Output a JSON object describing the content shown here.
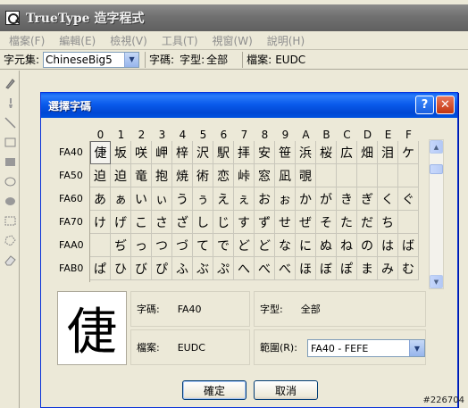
{
  "app": {
    "title": "TrueType 造字程式",
    "menu": [
      "檔案(F)",
      "編輯(E)",
      "檢視(V)",
      "工具(T)",
      "視窗(W)",
      "說明(H)"
    ],
    "toolbar": {
      "charset_label": "字元集:",
      "charset_value": "ChineseBig5",
      "code_label": "字碼:",
      "font_label": "字型:",
      "font_value": "全部",
      "file_label": "檔案:",
      "file_value": "EUDC"
    }
  },
  "dialog": {
    "title": "選擇字碼",
    "columns": [
      "0",
      "1",
      "2",
      "3",
      "4",
      "5",
      "6",
      "7",
      "8",
      "9",
      "A",
      "B",
      "C",
      "D",
      "E",
      "F"
    ],
    "rows": [
      {
        "code": "FA40",
        "chars": [
          "倢",
          "坂",
          "咲",
          "岬",
          "梓",
          "沢",
          "駅",
          "拝",
          "安",
          "笹",
          "浜",
          "桜",
          "広",
          "畑",
          "泪",
          "ケ"
        ]
      },
      {
        "code": "FA50",
        "chars": [
          "迫",
          "迫",
          "竜",
          "抱",
          "焼",
          "術",
          "恋",
          "峠",
          "窓",
          "凪",
          "覗",
          "",
          "",
          "",
          "",
          ""
        ]
      },
      {
        "code": "FA60",
        "chars": [
          "あ",
          "ぁ",
          "い",
          "ぃ",
          "う",
          "ぅ",
          "え",
          "ぇ",
          "お",
          "ぉ",
          "か",
          "が",
          "き",
          "ぎ",
          "く",
          "ぐ"
        ]
      },
      {
        "code": "FA70",
        "chars": [
          "け",
          "げ",
          "こ",
          "さ",
          "ざ",
          "し",
          "じ",
          "す",
          "ず",
          "せ",
          "ぜ",
          "そ",
          "た",
          "だ",
          "ち",
          ""
        ]
      },
      {
        "code": "FAA0",
        "chars": [
          "",
          "ぢ",
          "っ",
          "つ",
          "づ",
          "て",
          "で",
          "ど",
          "ど",
          "な",
          "に",
          "ぬ",
          "ね",
          "の",
          "は",
          "ば"
        ]
      },
      {
        "code": "FAB0",
        "chars": [
          "ぱ",
          "ひ",
          "び",
          "ぴ",
          "ふ",
          "ぶ",
          "ぷ",
          "へ",
          "べ",
          "べ",
          "ほ",
          "ぼ",
          "ぽ",
          "ま",
          "み",
          "む"
        ]
      }
    ],
    "selected_char": "倢",
    "info": {
      "code_label": "字碼:",
      "code_value": "FA40",
      "font_label": "字型:",
      "font_value": "全部",
      "file_label": "檔案:",
      "file_value": "EUDC",
      "range_label": "範圍(R):",
      "range_value": "FA40 - FEFE"
    },
    "ok_label": "確定",
    "cancel_label": "取消"
  },
  "watermark": "#226704"
}
